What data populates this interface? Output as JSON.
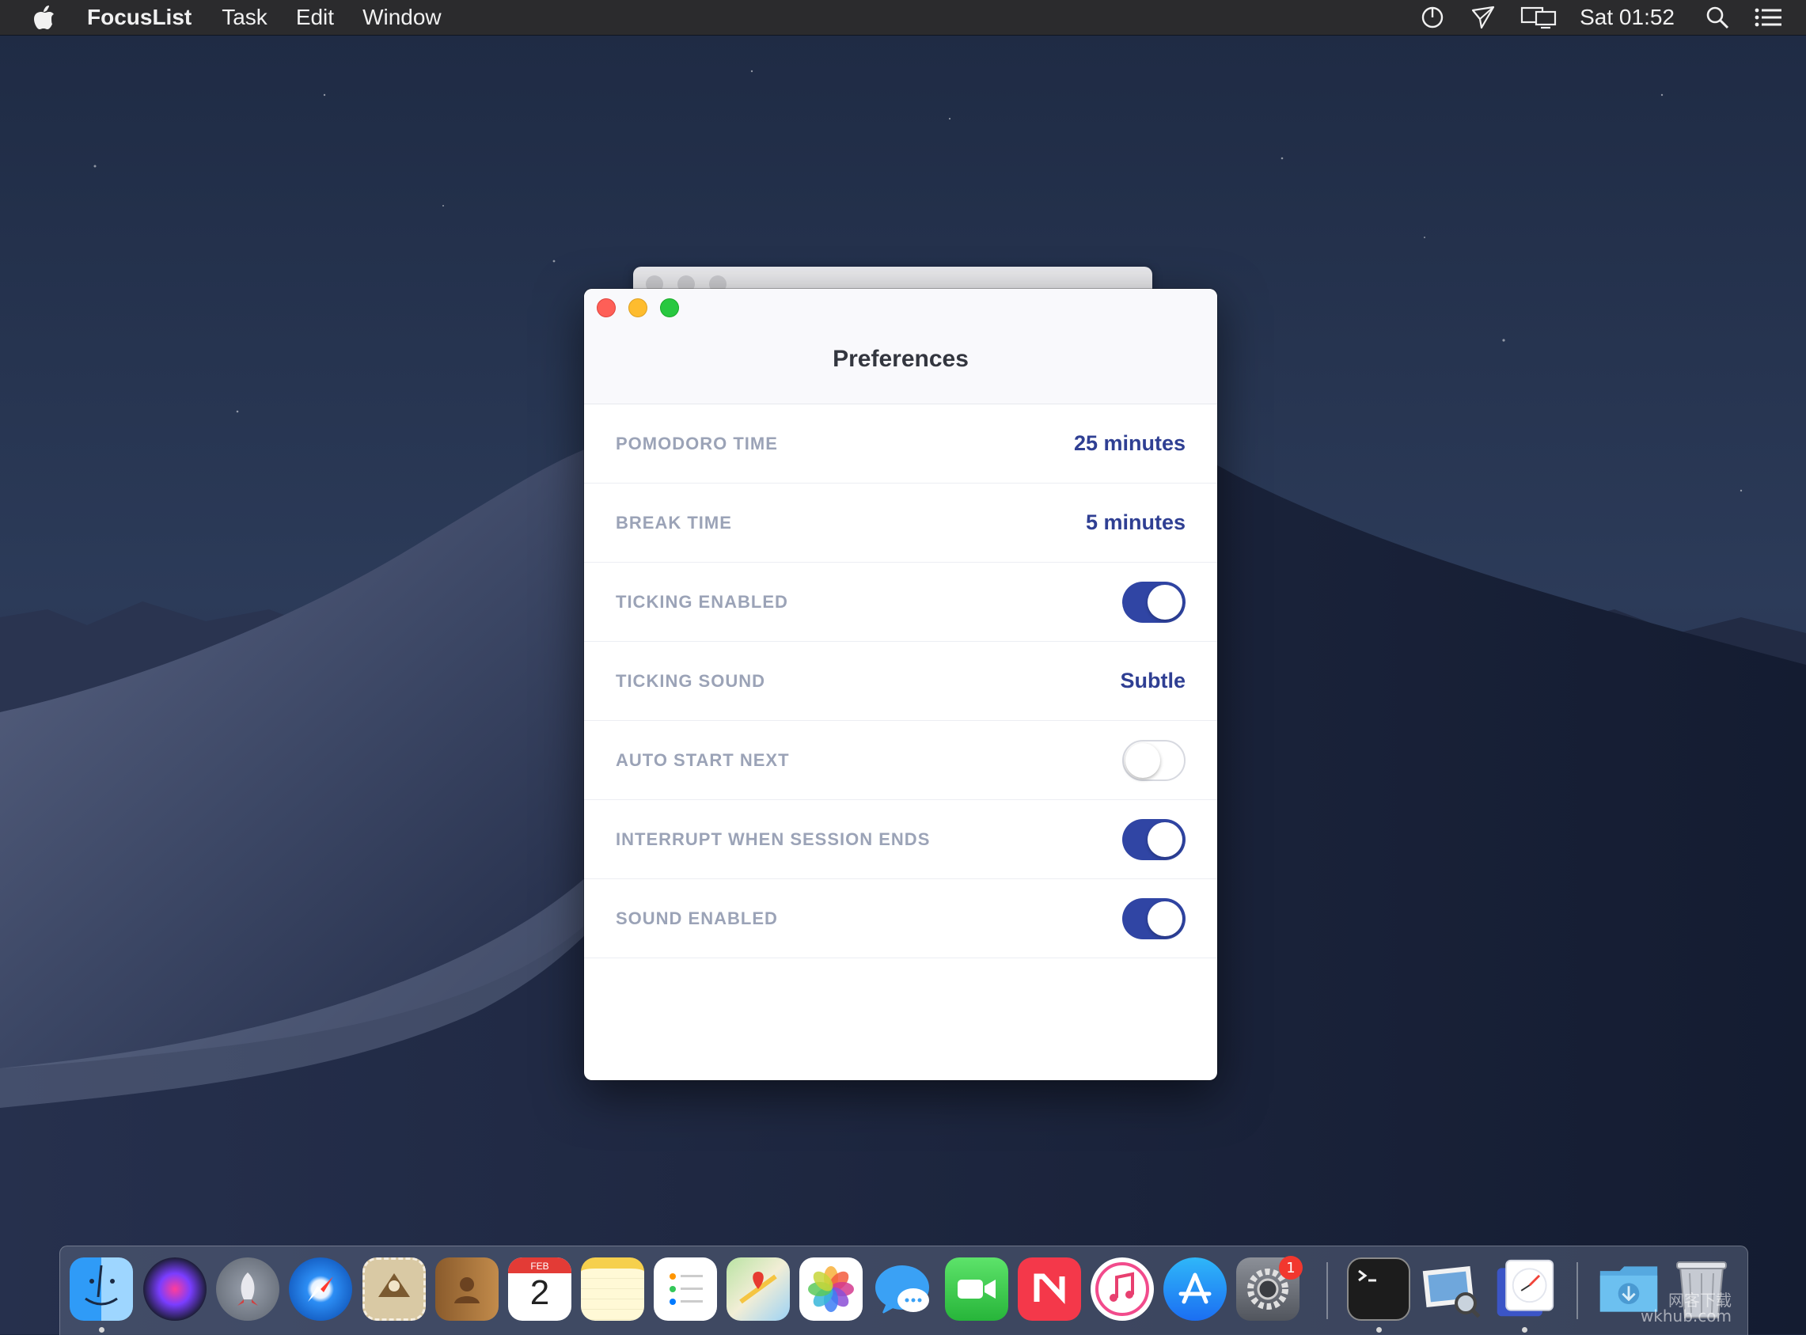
{
  "menubar": {
    "app_name": "FocusList",
    "menus": [
      "Task",
      "Edit",
      "Window"
    ],
    "clock": "Sat 01:52",
    "status_icons": [
      "timer-icon",
      "airdrop-icon",
      "airplay-display-icon",
      "spotlight-search-icon",
      "notification-center-icon"
    ]
  },
  "preferences": {
    "title": "Preferences",
    "rows": [
      {
        "label": "POMODORO TIME",
        "value": "25 minutes"
      },
      {
        "label": "BREAK TIME",
        "value": "5 minutes"
      },
      {
        "label": "TICKING ENABLED",
        "toggle": true
      },
      {
        "label": "TICKING SOUND",
        "value": "Subtle"
      },
      {
        "label": "AUTO START NEXT",
        "toggle": false
      },
      {
        "label": "INTERRUPT WHEN SESSION ENDS",
        "toggle": true
      },
      {
        "label": "SOUND ENABLED",
        "toggle": true
      }
    ]
  },
  "dock": {
    "apps": [
      "Finder",
      "Siri",
      "Launchpad",
      "Safari",
      "Mail",
      "Contacts",
      "Calendar",
      "Notes",
      "Reminders",
      "Maps",
      "Photos",
      "Messages",
      "FaceTime",
      "News",
      "iTunes",
      "App Store",
      "System Preferences",
      "Terminal",
      "Preview",
      "FocusList",
      "Downloads",
      "Trash"
    ],
    "calendar_month": "FEB",
    "calendar_day": "2",
    "system_preferences_badge": "1"
  },
  "watermark": {
    "line1": "网客下载",
    "line2": "wkhub.com"
  },
  "colors": {
    "accent": "#3045a4",
    "value_text": "#2f3f93",
    "label_text": "#9ba3b7",
    "close": "#fe5f57",
    "minimize": "#febc2e",
    "zoom": "#28c840"
  }
}
